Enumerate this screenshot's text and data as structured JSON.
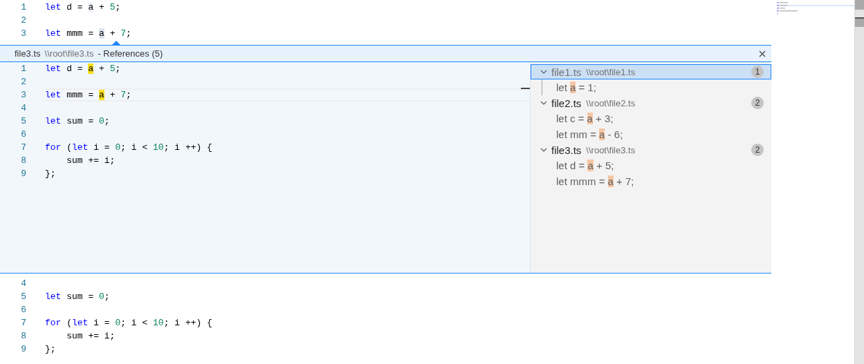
{
  "top_editor": {
    "lines": [
      {
        "number": "1",
        "tokens": [
          {
            "kind": "keyword",
            "text": "let"
          },
          {
            "kind": "plain",
            "text": " d = "
          },
          {
            "kind": "highlight_faint",
            "text": "a"
          },
          {
            "kind": "plain",
            "text": " + "
          },
          {
            "kind": "number",
            "text": "5"
          },
          {
            "kind": "plain",
            "text": ";"
          }
        ]
      },
      {
        "number": "2"
      },
      {
        "number": "3",
        "tokens": [
          {
            "kind": "keyword",
            "text": "let"
          },
          {
            "kind": "plain",
            "text": " mmm = "
          },
          {
            "kind": "highlight",
            "text": "a"
          },
          {
            "kind": "plain",
            "text": " + "
          },
          {
            "kind": "number",
            "text": "7"
          },
          {
            "kind": "plain",
            "text": ";"
          }
        ]
      }
    ]
  },
  "peek": {
    "header": {
      "file": "file3.ts",
      "path": "\\\\root\\file3.ts",
      "title": "- References (5)"
    },
    "editor": {
      "lines": [
        {
          "number": "1",
          "current": false,
          "tokens": [
            {
              "kind": "keyword",
              "text": "let"
            },
            {
              "kind": "plain",
              "text": " d = "
            },
            {
              "kind": "reference",
              "text": "a"
            },
            {
              "kind": "plain",
              "text": " + "
            },
            {
              "kind": "number",
              "text": "5"
            },
            {
              "kind": "plain",
              "text": ";"
            }
          ]
        },
        {
          "number": "2",
          "current": false
        },
        {
          "number": "3",
          "current": true,
          "tokens": [
            {
              "kind": "keyword",
              "text": "let"
            },
            {
              "kind": "plain",
              "text": " mmm = "
            },
            {
              "kind": "reference",
              "text": "a"
            },
            {
              "kind": "plain",
              "text": " + "
            },
            {
              "kind": "number",
              "text": "7"
            },
            {
              "kind": "plain",
              "text": ";"
            }
          ]
        },
        {
          "number": "4",
          "current": false
        },
        {
          "number": "5",
          "current": false,
          "tokens": [
            {
              "kind": "keyword",
              "text": "let"
            },
            {
              "kind": "plain",
              "text": " sum = "
            },
            {
              "kind": "number",
              "text": "0"
            },
            {
              "kind": "plain",
              "text": ";"
            }
          ]
        },
        {
          "number": "6",
          "current": false
        },
        {
          "number": "7",
          "current": false,
          "tokens": [
            {
              "kind": "keyword",
              "text": "for"
            },
            {
              "kind": "plain",
              "text": " ("
            },
            {
              "kind": "keyword",
              "text": "let"
            },
            {
              "kind": "plain",
              "text": " i = "
            },
            {
              "kind": "number",
              "text": "0"
            },
            {
              "kind": "plain",
              "text": "; i < "
            },
            {
              "kind": "number",
              "text": "10"
            },
            {
              "kind": "plain",
              "text": "; i ++) {"
            }
          ]
        },
        {
          "number": "8",
          "current": false,
          "tokens": [
            {
              "kind": "plain",
              "text": "    sum += i;"
            }
          ]
        },
        {
          "number": "9",
          "current": false,
          "tokens": [
            {
              "kind": "plain",
              "text": "};"
            }
          ]
        }
      ]
    },
    "references": [
      {
        "file": "file1.ts",
        "path": "\\\\root\\file1.ts",
        "count": "1",
        "expanded": true,
        "selected": true,
        "matches": [
          [
            {
              "kind": "plain",
              "text": "let "
            },
            {
              "kind": "match",
              "text": "a"
            },
            {
              "kind": "plain",
              "text": " = 1;"
            }
          ]
        ]
      },
      {
        "file": "file2.ts",
        "path": "\\\\root\\file2.ts",
        "count": "2",
        "expanded": true,
        "selected": false,
        "matches": [
          [
            {
              "kind": "plain",
              "text": "let c = "
            },
            {
              "kind": "match",
              "text": "a"
            },
            {
              "kind": "plain",
              "text": " + 3;"
            }
          ],
          [
            {
              "kind": "plain",
              "text": "let mm = "
            },
            {
              "kind": "match",
              "text": "a"
            },
            {
              "kind": "plain",
              "text": " - 6;"
            }
          ]
        ]
      },
      {
        "file": "file3.ts",
        "path": "\\\\root\\file3.ts",
        "count": "2",
        "expanded": true,
        "selected": false,
        "matches": [
          [
            {
              "kind": "plain",
              "text": "let d = "
            },
            {
              "kind": "match",
              "text": "a"
            },
            {
              "kind": "plain",
              "text": " + 5;"
            }
          ],
          [
            {
              "kind": "plain",
              "text": "let mmm = "
            },
            {
              "kind": "match",
              "text": "a"
            },
            {
              "kind": "plain",
              "text": " + 7;"
            }
          ]
        ]
      }
    ]
  },
  "bottom_editor": {
    "lines": [
      {
        "number": "4"
      },
      {
        "number": "5",
        "tokens": [
          {
            "kind": "keyword",
            "text": "let"
          },
          {
            "kind": "plain",
            "text": " sum = "
          },
          {
            "kind": "number",
            "text": "0"
          },
          {
            "kind": "plain",
            "text": ";"
          }
        ]
      },
      {
        "number": "6"
      },
      {
        "number": "7",
        "tokens": [
          {
            "kind": "keyword",
            "text": "for"
          },
          {
            "kind": "plain",
            "text": " ("
          },
          {
            "kind": "keyword",
            "text": "let"
          },
          {
            "kind": "plain",
            "text": " i = "
          },
          {
            "kind": "number",
            "text": "0"
          },
          {
            "kind": "plain",
            "text": "; i < "
          },
          {
            "kind": "number",
            "text": "10"
          },
          {
            "kind": "plain",
            "text": "; i ++) {"
          }
        ]
      },
      {
        "number": "8",
        "tokens": [
          {
            "kind": "plain",
            "text": "    sum += i;"
          }
        ]
      },
      {
        "number": "9",
        "tokens": [
          {
            "kind": "plain",
            "text": "};"
          }
        ]
      }
    ]
  }
}
